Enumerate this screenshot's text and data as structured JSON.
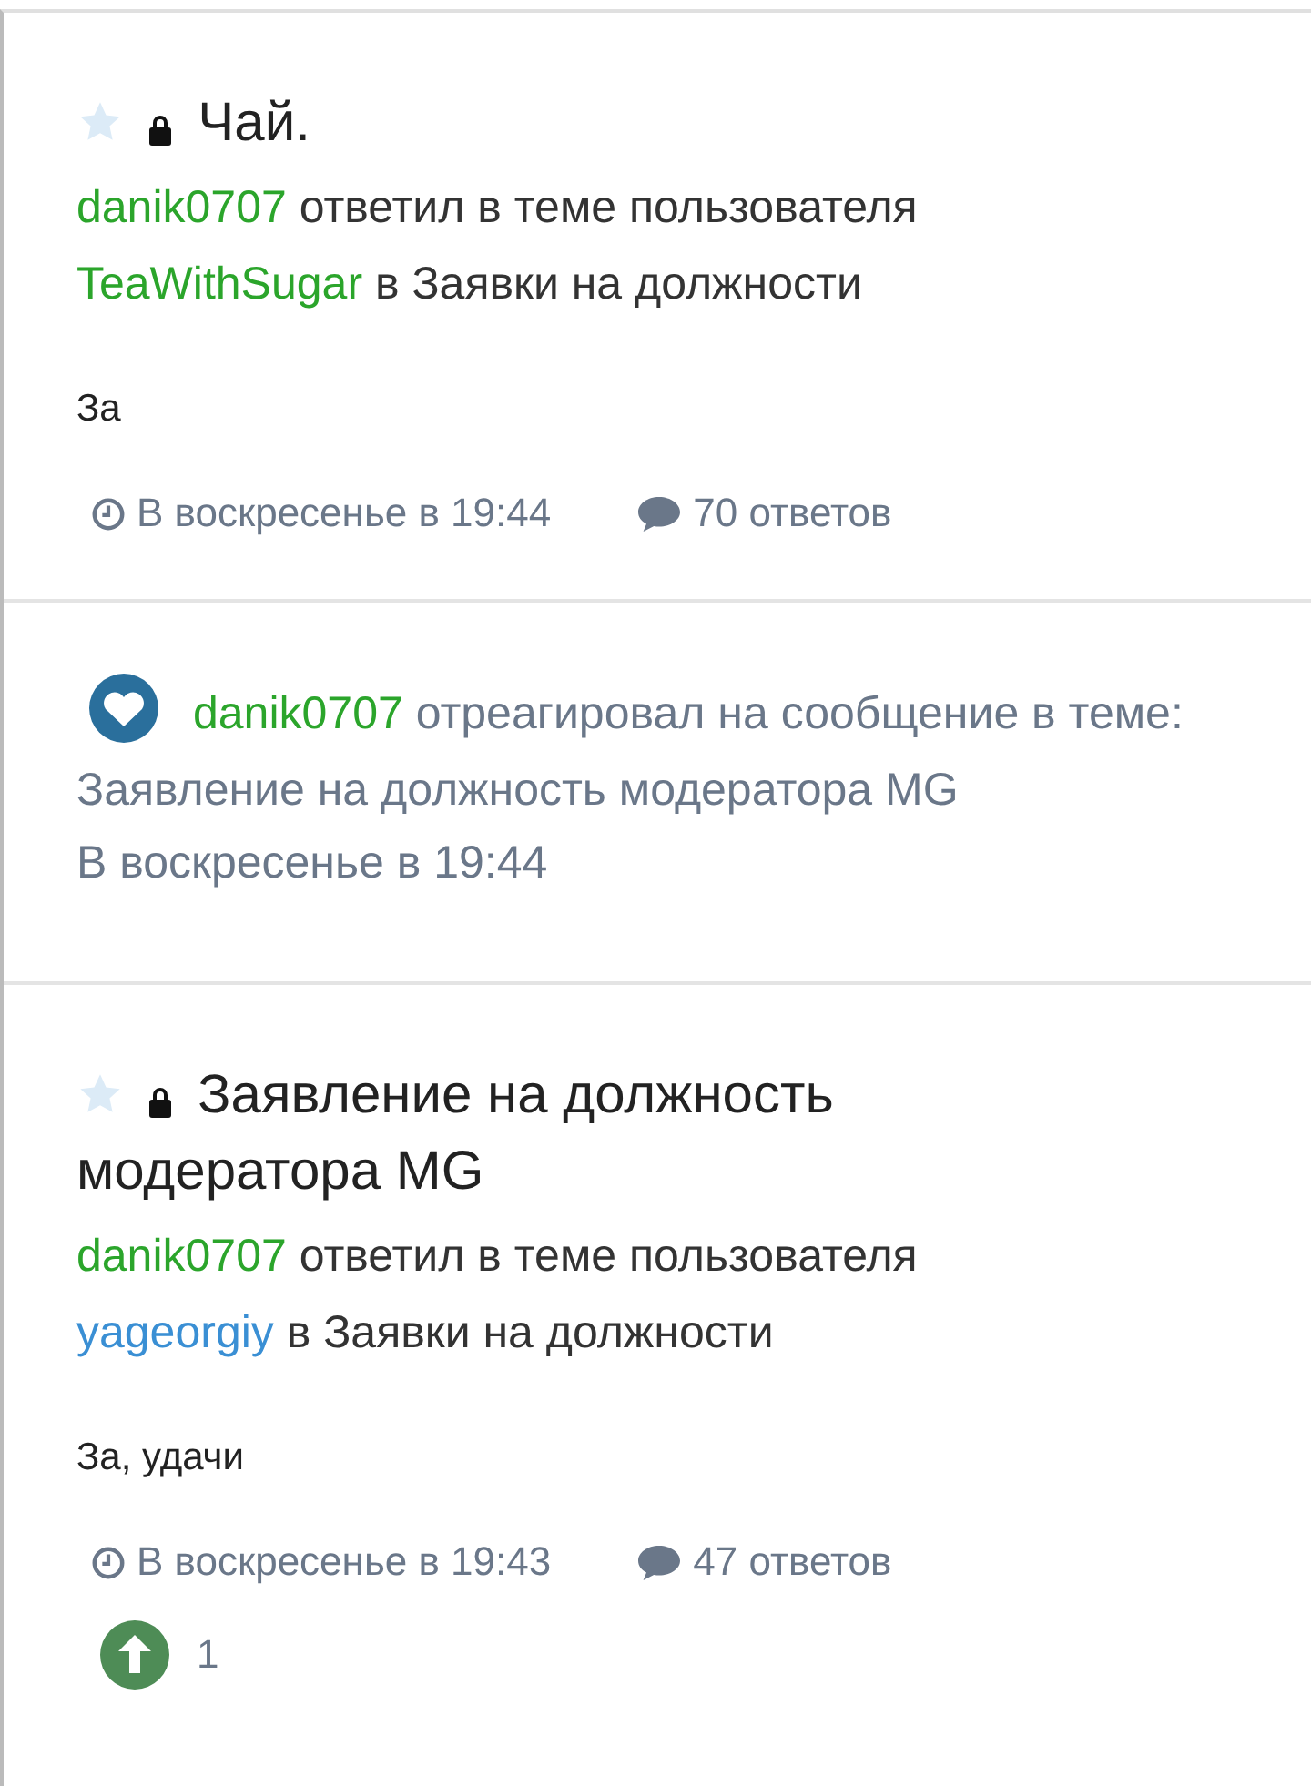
{
  "items": [
    {
      "kind": "post",
      "followed": false,
      "locked": true,
      "title": "Чай.",
      "user": "danik0707",
      "action": "ответил в теме пользователя",
      "author": {
        "name": "TeaWithSugar",
        "color": "#2ba52b"
      },
      "forum_text": "в Заявки на должности",
      "snippet": "За",
      "time": "В воскресенье в 19:44",
      "replies": "70 ответов"
    },
    {
      "kind": "reaction",
      "user": "danik0707",
      "text": "отреагировал на сообщение в теме: Заявление на должность модератора MG",
      "time": "В воскресенье в 19:44"
    },
    {
      "kind": "post",
      "followed": false,
      "locked": true,
      "title": "Заявление на должность модератора MG",
      "user": "danik0707",
      "action": "ответил в теме пользователя",
      "author": {
        "name": "yageorgiy",
        "color": "#3a8fd4"
      },
      "forum_text": "в Заявки на должности",
      "snippet": "За, удачи",
      "time": "В воскресенье в 19:43",
      "replies": "47 ответов",
      "upvotes": "1"
    }
  ]
}
